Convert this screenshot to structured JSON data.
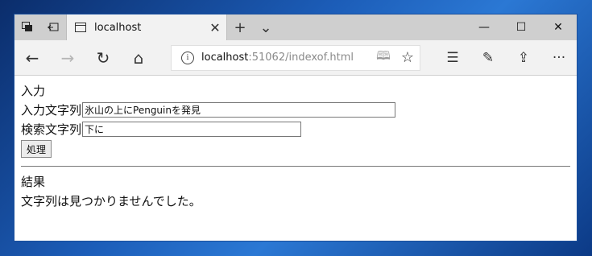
{
  "browser": {
    "tab_title": "localhost",
    "tab_close": "✕",
    "new_tab": "+",
    "tab_list": "⌄",
    "window_buttons": {
      "minimize": "—",
      "maximize": "☐",
      "close": "✕"
    },
    "nav": {
      "back": "←",
      "forward": "→",
      "refresh": "↻",
      "home": "⌂"
    },
    "address": {
      "host": "localhost",
      "rest": ":51062/indexof.html",
      "info": "i"
    },
    "address_icons": {
      "reading": "🕮",
      "favorite": "☆"
    },
    "tools": {
      "hub": "☰",
      "notes": "✎",
      "share": "⇪",
      "more": "···"
    }
  },
  "page": {
    "input_heading": "入力",
    "source_label": "入力文字列",
    "source_value": "氷山の上にPenguinを発見",
    "search_label": "検索文字列",
    "search_value": "下に",
    "submit_label": "処理",
    "result_heading": "結果",
    "result_text": "文字列は見つかりませんでした。"
  },
  "colors": {
    "accent": "#1a4f9c",
    "tabstrip": "#cfcfcf",
    "toolbar": "#f2f2f2"
  }
}
